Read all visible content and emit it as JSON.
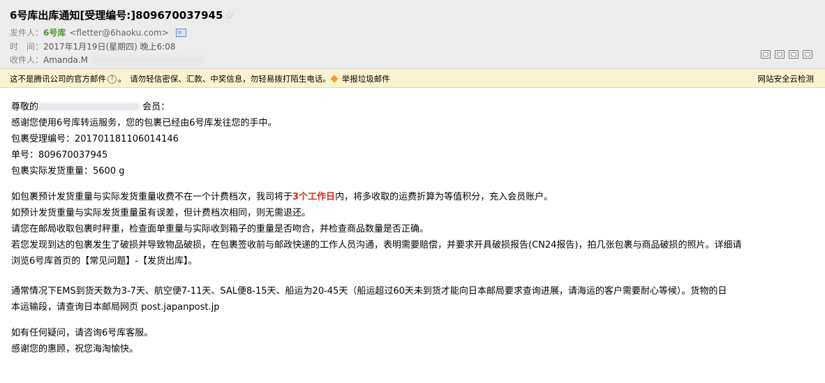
{
  "header": {
    "subject": "6号库出库通知[受理编号:]809670037945",
    "star_icon": "star-icon",
    "from_label": "发件人：",
    "from_name": "6号库",
    "from_email": "<fletter@6haoku.com>",
    "time_label": "时　间：",
    "time_value": "2017年1月19日(星期四) 晚上6:08",
    "to_label": "收件人：",
    "to_name": "Amanda.M"
  },
  "toolbar": {
    "icons": [
      "new-window-icon",
      "open-window-icon",
      "save-icon",
      "print-icon"
    ]
  },
  "warning": {
    "text1": "这不是腾讯公司的官方邮件",
    "text2": "。　请勿轻信密保、汇款、中奖信息，勿轻易拨打陌生电话。",
    "report_label": "举报垃圾邮件",
    "security_link": "网站安全云检测"
  },
  "body": {
    "greeting_prefix": "尊敬的",
    "greeting_suffix": " 会员：",
    "thanks": "感谢您使用6号库转运服务，您的包裹已经由6号库发往您的手中。",
    "tracking_label": "包裹受理编号：",
    "tracking_value": "20170118110601 4146",
    "order_label": "单号：",
    "order_value": "809670037945",
    "weight_label": "包裹实际发货重量：",
    "weight_value": "5600 g",
    "para1_before": "如包裹预计发货重量与实际发货重量收费不在一个计费档次，我司将于",
    "para1_highlight": "3个工作日",
    "para1_after": "内，将多收取的运费折算为等值积分，充入会员账户。",
    "para2": "如预计发货重量与实际发货重量虽有误差，但计费档次相同，则无需退还。",
    "para3": "请您在邮局收取包裹时秤重，检查面单重量与实际收到箱子的重量是否吻合，并检查商品数量是否正确。",
    "para4_line1": "若您发现到达的包裹发生了破损并导致物品破损，在包裹签收前与邮政快递的工作人员沟通，表明需要赔偿，并要求开具破损报告(CN24报告)，拍几张包裹与商品破损的照片。详细请",
    "para4_line2": "浏览6号库首页的【常见问题】-【发货出库】。",
    "para5_line1": "通常情况下EMS到货天数为3-7天、航空便7-11天、SAL便8-15天、船运为20-45天（船运超过60天未到货才能向日本邮局要求查询进展，请海运的客户需要耐心等候）。货物的日",
    "para5_line2": "本运输段，请查询日本邮局网页 post.japanpost.jp",
    "para6": "如有任何疑问，请咨询6号库客服。",
    "para7": "感谢您的惠顾，祝您海淘愉快。"
  },
  "colors": {
    "header_bg": "#ececec",
    "warning_bg": "#fbf3cf",
    "sender_green": "#4a9a2a",
    "highlight_red": "#d62a1f"
  }
}
